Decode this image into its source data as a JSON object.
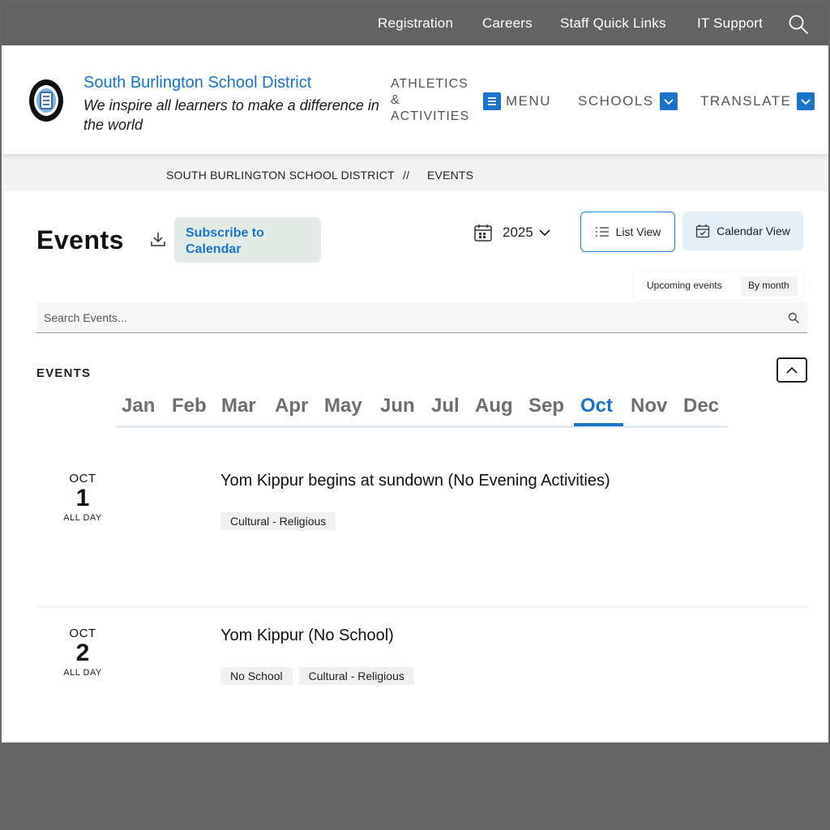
{
  "utility_nav": {
    "links": [
      "Registration",
      "Careers",
      "Staff Quick Links",
      "IT Support"
    ]
  },
  "header": {
    "site_name": "South Burlington School District",
    "tagline": "We inspire all learners to make a difference in the world",
    "nav": {
      "athletics": "ATHLETICS & ACTIVITIES",
      "menu": "MENU",
      "schools": "SCHOOLS",
      "translate": "TRANSLATE"
    }
  },
  "breadcrumb": {
    "home": "SOUTH BURLINGTON SCHOOL DISTRICT",
    "separator": "//",
    "current": "EVENTS"
  },
  "toolbar": {
    "title": "Events",
    "subscribe": "Subscribe to Calendar",
    "year": "2025",
    "list_view": "List View",
    "calendar_view": "Calendar View",
    "toggle_upcoming": "Upcoming events",
    "toggle_bymonth": "By month",
    "search_placeholder": "Search Events..."
  },
  "events_section": {
    "label": "EVENTS",
    "months": [
      "Jan",
      "Feb",
      "Mar",
      "Apr",
      "May",
      "Jun",
      "Jul",
      "Aug",
      "Sep",
      "Oct",
      "Nov",
      "Dec"
    ],
    "active_month": "Oct",
    "items": [
      {
        "month": "OCT",
        "day": "1",
        "time": "ALL DAY",
        "title": "Yom Kippur begins at sundown (No Evening Activities)",
        "tags": [
          "Cultural - Religious"
        ]
      },
      {
        "month": "OCT",
        "day": "2",
        "time": "ALL DAY",
        "title": "Yom Kippur (No School)",
        "tags": [
          "No School",
          "Cultural - Religious"
        ]
      }
    ]
  },
  "colors": {
    "brand_blue": "#1a73c8",
    "utility_bar": "#636363"
  }
}
